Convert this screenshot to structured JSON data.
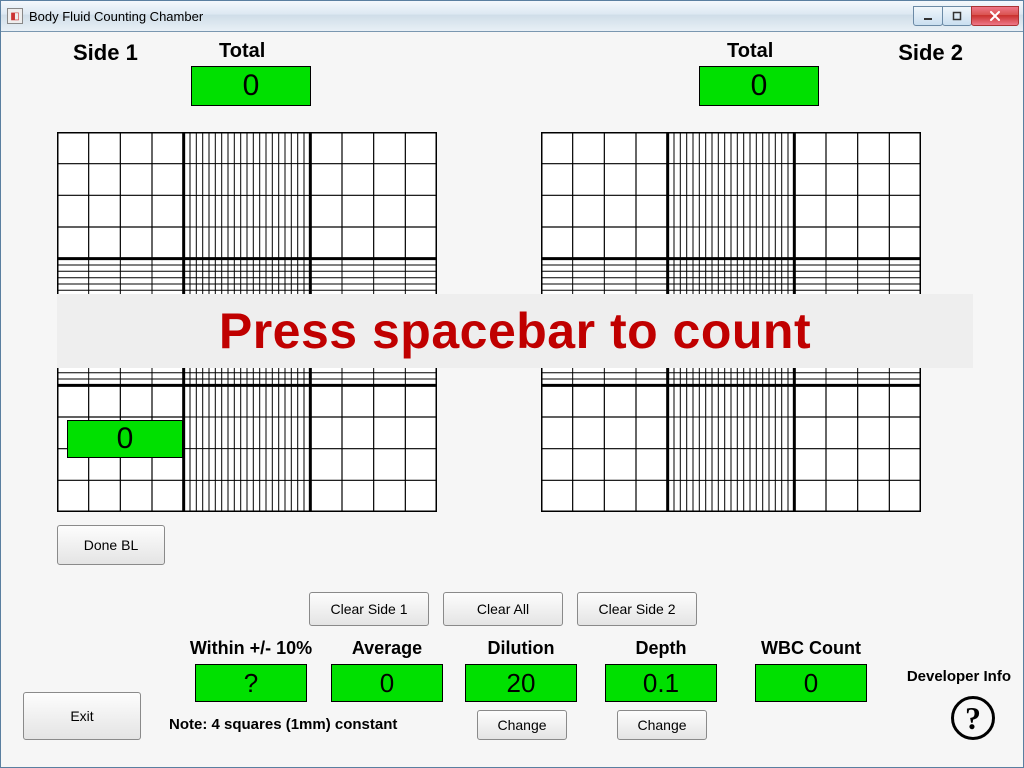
{
  "window": {
    "title": "Body Fluid Counting Chamber"
  },
  "labels": {
    "side1": "Side 1",
    "side2": "Side 2",
    "total": "Total",
    "within10": "Within +/- 10%",
    "average": "Average",
    "dilution": "Dilution",
    "depth": "Depth",
    "wbcCount": "WBC Count",
    "note": "Note: 4 squares (1mm) constant",
    "developerInfo": "Developer Info",
    "help": "?"
  },
  "buttons": {
    "doneBL": "Done BL",
    "clearSide1": "Clear Side 1",
    "clearAll": "Clear All",
    "clearSide2": "Clear Side 2",
    "exit": "Exit",
    "change": "Change"
  },
  "totals": {
    "side1": "0",
    "side2": "0"
  },
  "banner": "Press spacebar to count",
  "currentSquare": "0",
  "stats": {
    "within10": "?",
    "average": "0",
    "dilution": "20",
    "depth": "0.1",
    "wbcCount": "0"
  },
  "colors": {
    "accent": "#00e000",
    "bannerText": "#c00000"
  }
}
